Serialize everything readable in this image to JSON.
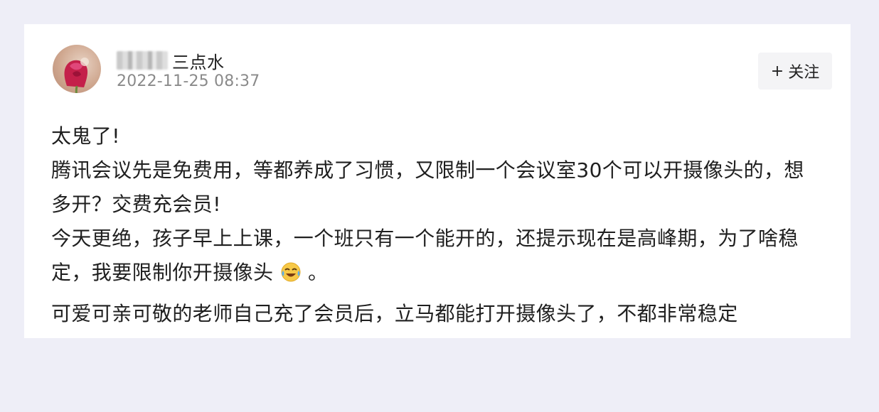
{
  "post": {
    "author_name_visible": "三点水",
    "timestamp": "2022-11-25 08:37",
    "follow_label": "关注",
    "follow_icon": "plus-icon",
    "avatar_icon": "avatar-rose-icon",
    "emoji_icon": "laughing-crying-emoji-icon",
    "lines": [
      "太鬼了!",
      "腾讯会议先是免费用，等都养成了习惯，又限制一个会议室30个可以开摄像头的，想",
      "多开？交费充会员!",
      "今天更绝，孩子早上上课，一个班只有一个能开的，还提示现在是高峰期，为了啥稳",
      "定，我要限制你开摄像头",
      "。",
      "可爱可亲可敬的老师自己充了会员后，立马都能打开摄像头了，不都非常稳定"
    ]
  },
  "colors": {
    "page_background": "#eeeef7",
    "card_background": "#ffffff",
    "text_primary": "#1f1f1f",
    "text_secondary": "#8a8a8a",
    "button_background": "#f4f4f6"
  }
}
